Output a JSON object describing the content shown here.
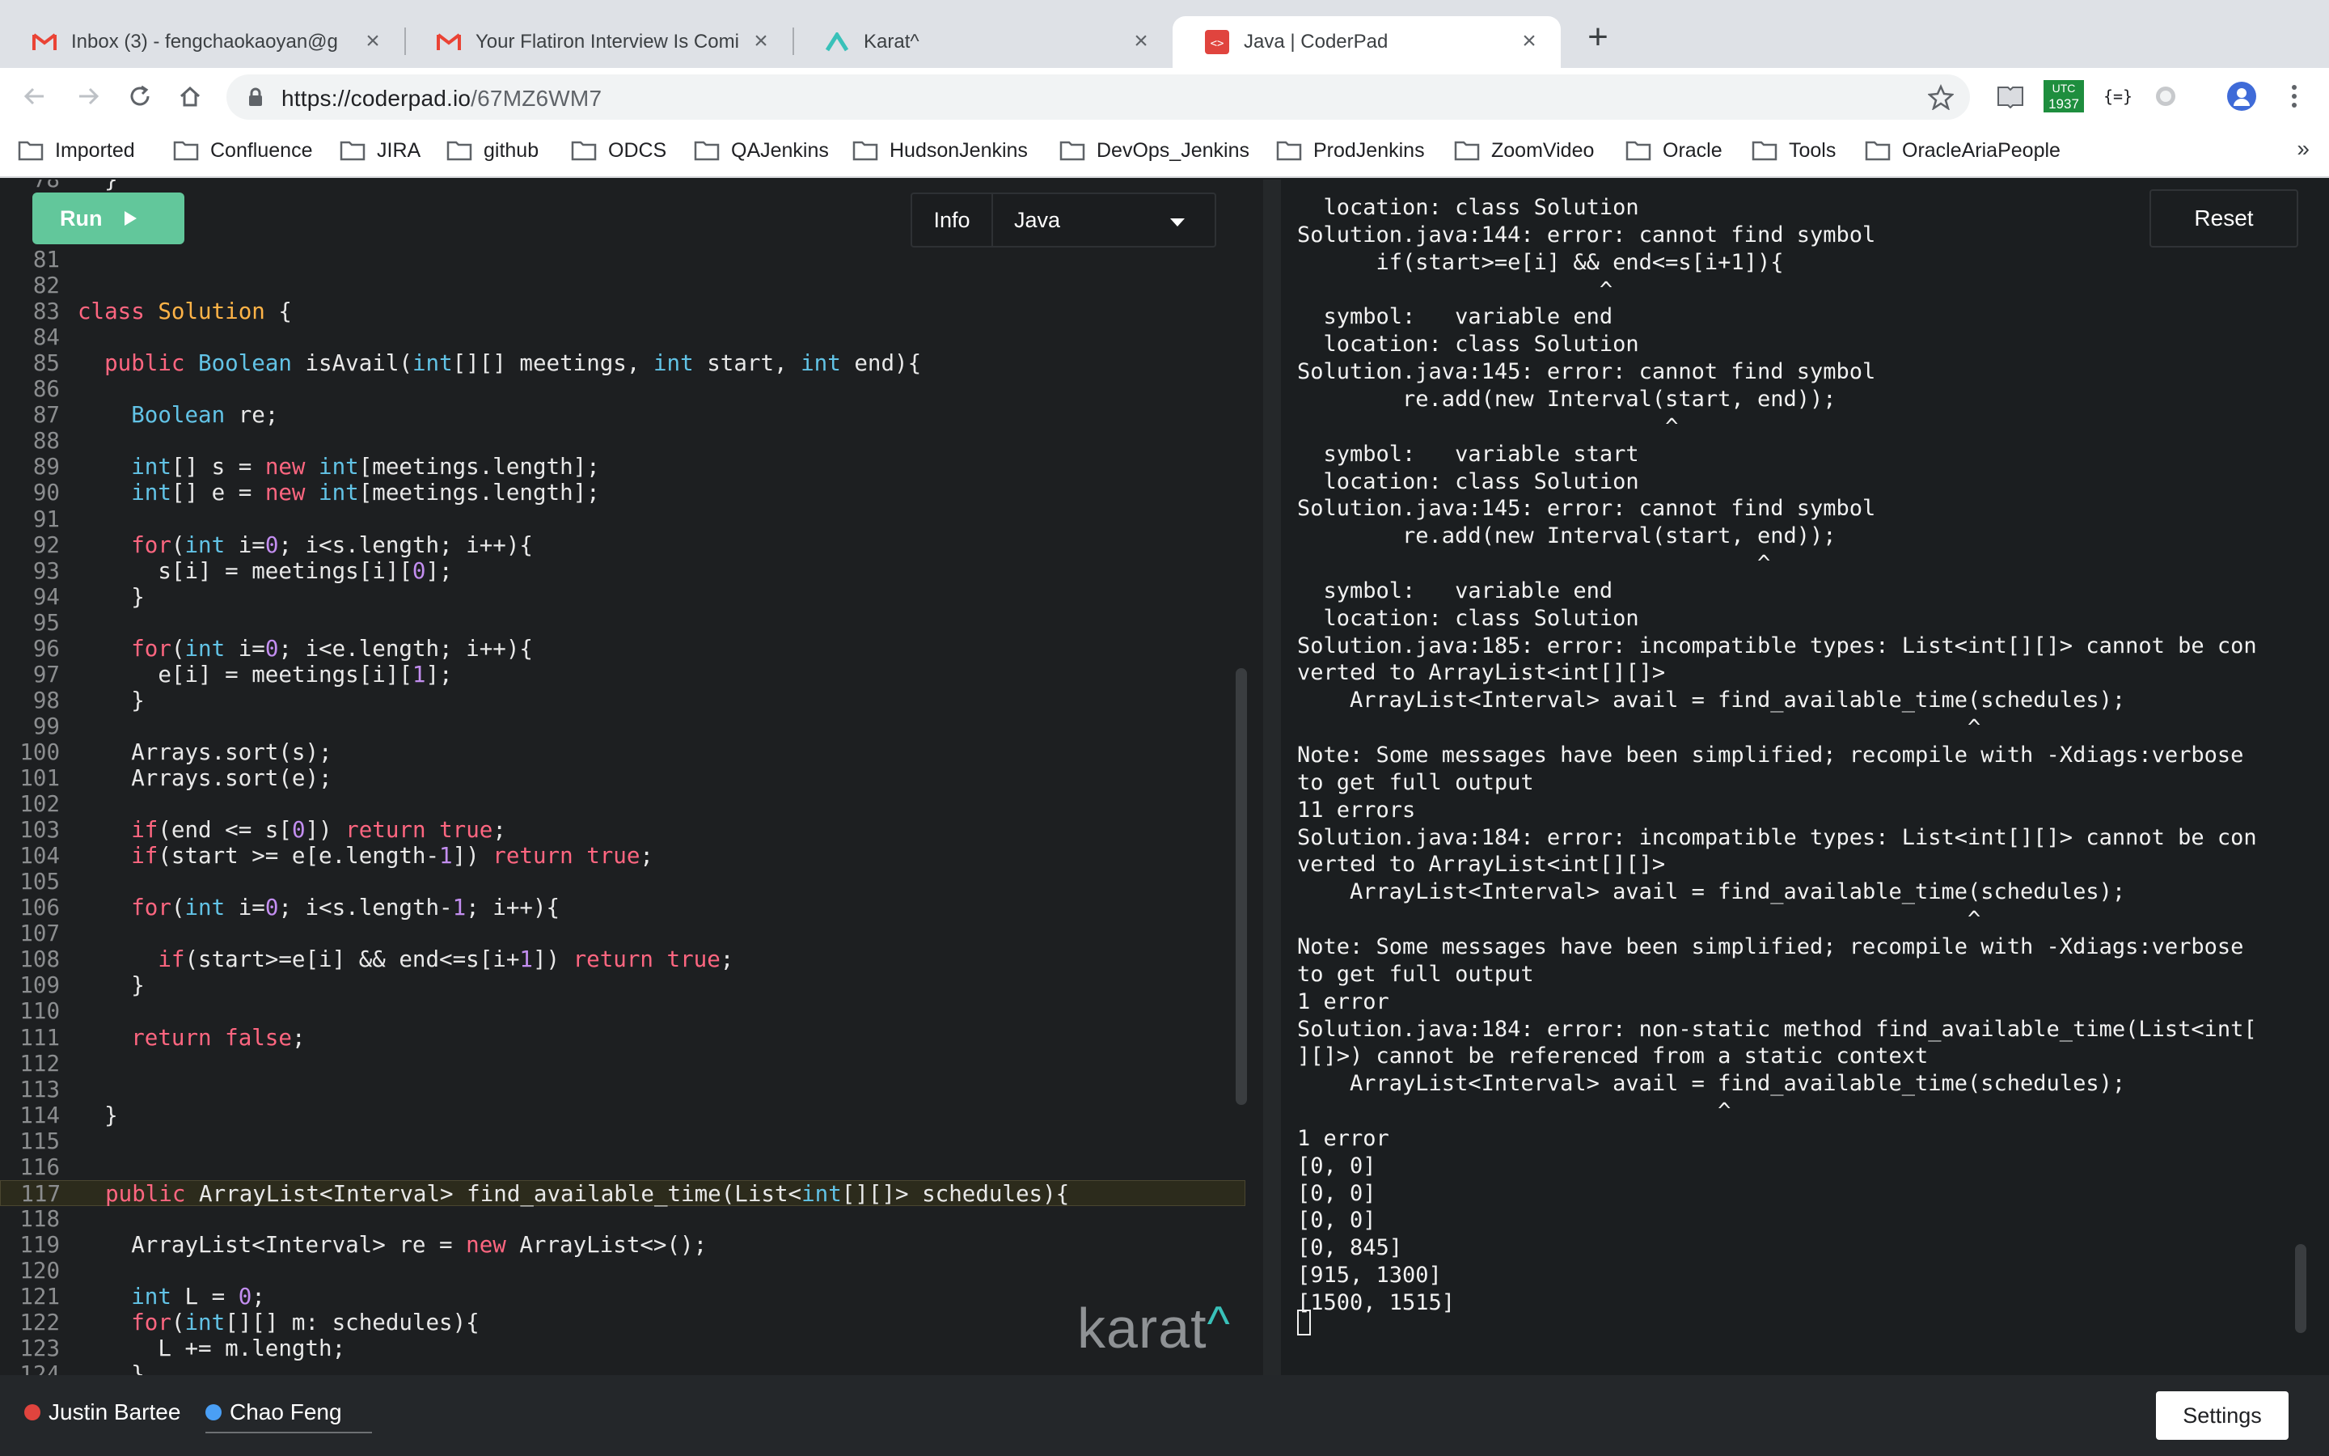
{
  "browser": {
    "tabs": [
      {
        "title": "Inbox (3) - fengchaokaoyan@g",
        "icon": "gmail-icon"
      },
      {
        "title": "Your Flatiron Interview Is Comin",
        "icon": "gmail-icon"
      },
      {
        "title": "Karat^",
        "icon": "karat-icon"
      },
      {
        "title": "Java | CoderPad",
        "icon": "coderpad-icon"
      }
    ],
    "url_host": "https://coderpad.io",
    "url_path": "/67MZ6WM7",
    "ext_badge": "1937",
    "ext_badge_top": "UTC",
    "json_ext": "{=}",
    "bookmarks": [
      "Imported",
      "Confluence",
      "JIRA",
      "github",
      "ODCS",
      "QAJenkins",
      "HudsonJenkins",
      "DevOps_Jenkins",
      "ProdJenkins",
      "ZoomVideo",
      "Oracle",
      "Tools",
      "OracleAriaPeople"
    ],
    "bookmarks_more": "»"
  },
  "toolbar": {
    "run_label": "Run",
    "info_label": "Info",
    "language": "Java",
    "reset_label": "Reset"
  },
  "editor": {
    "partial_top_line": "78",
    "partial_bottom_line": "124",
    "lines": [
      {
        "n": "81",
        "code": ""
      },
      {
        "n": "82",
        "code": ""
      },
      {
        "n": "83",
        "code": "class Solution {"
      },
      {
        "n": "84",
        "code": ""
      },
      {
        "n": "85",
        "code": "  public Boolean isAvail(int[][] meetings, int start, int end){"
      },
      {
        "n": "86",
        "code": ""
      },
      {
        "n": "87",
        "code": "    Boolean re;"
      },
      {
        "n": "88",
        "code": ""
      },
      {
        "n": "89",
        "code": "    int[] s = new int[meetings.length];"
      },
      {
        "n": "90",
        "code": "    int[] e = new int[meetings.length];"
      },
      {
        "n": "91",
        "code": ""
      },
      {
        "n": "92",
        "code": "    for(int i=0; i<s.length; i++){"
      },
      {
        "n": "93",
        "code": "      s[i] = meetings[i][0];"
      },
      {
        "n": "94",
        "code": "    }"
      },
      {
        "n": "95",
        "code": ""
      },
      {
        "n": "96",
        "code": "    for(int i=0; i<e.length; i++){"
      },
      {
        "n": "97",
        "code": "      e[i] = meetings[i][1];"
      },
      {
        "n": "98",
        "code": "    }"
      },
      {
        "n": "99",
        "code": ""
      },
      {
        "n": "100",
        "code": "    Arrays.sort(s);"
      },
      {
        "n": "101",
        "code": "    Arrays.sort(e);"
      },
      {
        "n": "102",
        "code": ""
      },
      {
        "n": "103",
        "code": "    if(end <= s[0]) return true;"
      },
      {
        "n": "104",
        "code": "    if(start >= e[e.length-1]) return true;"
      },
      {
        "n": "105",
        "code": ""
      },
      {
        "n": "106",
        "code": "    for(int i=0; i<s.length-1; i++){"
      },
      {
        "n": "107",
        "code": ""
      },
      {
        "n": "108",
        "code": "      if(start>=e[i] && end<=s[i+1]) return true;"
      },
      {
        "n": "109",
        "code": "    }"
      },
      {
        "n": "110",
        "code": ""
      },
      {
        "n": "111",
        "code": "    return false;"
      },
      {
        "n": "112",
        "code": ""
      },
      {
        "n": "113",
        "code": ""
      },
      {
        "n": "114",
        "code": "  }"
      },
      {
        "n": "115",
        "code": ""
      },
      {
        "n": "116",
        "code": ""
      },
      {
        "n": "117",
        "code": "  public ArrayList<Interval> find_available_time(List<int[][]> schedules){",
        "highlight": true
      },
      {
        "n": "118",
        "code": ""
      },
      {
        "n": "119",
        "code": "    ArrayList<Interval> re = new ArrayList<>();"
      },
      {
        "n": "120",
        "code": ""
      },
      {
        "n": "121",
        "code": "    int L = 0;"
      },
      {
        "n": "122",
        "code": "    for(int[][] m: schedules){"
      },
      {
        "n": "123",
        "code": "      L += m.length;"
      }
    ]
  },
  "console": {
    "lines": [
      "  location: class Solution",
      "Solution.java:144: error: cannot find symbol",
      "      if(start>=e[i] && end<=s[i+1]){",
      "                       ^",
      "  symbol:   variable end",
      "  location: class Solution",
      "Solution.java:145: error: cannot find symbol",
      "        re.add(new Interval(start, end));",
      "                            ^",
      "  symbol:   variable start",
      "  location: class Solution",
      "Solution.java:145: error: cannot find symbol",
      "        re.add(new Interval(start, end));",
      "                                   ^",
      "  symbol:   variable end",
      "  location: class Solution",
      "Solution.java:185: error: incompatible types: List<int[][]> cannot be con",
      "verted to ArrayList<int[][]>",
      "    ArrayList<Interval> avail = find_available_time(schedules);",
      "                                                   ^",
      "Note: Some messages have been simplified; recompile with -Xdiags:verbose",
      "to get full output",
      "11 errors",
      "Solution.java:184: error: incompatible types: List<int[][]> cannot be con",
      "verted to ArrayList<int[][]>",
      "    ArrayList<Interval> avail = find_available_time(schedules);",
      "                                                   ^",
      "Note: Some messages have been simplified; recompile with -Xdiags:verbose",
      "to get full output",
      "1 error",
      "Solution.java:184: error: non-static method find_available_time(List<int[",
      "][]>) cannot be referenced from a static context",
      "    ArrayList<Interval> avail = find_available_time(schedules);",
      "                                ^",
      "1 error",
      "[0, 0]",
      "[0, 0]",
      "[0, 0]",
      "[0, 845]",
      "[915, 1300]",
      "[1500, 1515]"
    ]
  },
  "footer": {
    "users": [
      {
        "name": "Justin Bartee",
        "color": "#e0443e"
      },
      {
        "name": "Chao Feng",
        "color": "#4a9ff5"
      }
    ],
    "settings_label": "Settings"
  },
  "branding": {
    "logo": "karat",
    "logo_mark": "^"
  },
  "colors": {
    "run_button": "#62c79b",
    "editor_bg": "#1d1f21",
    "console_bg": "#1b1e20"
  }
}
